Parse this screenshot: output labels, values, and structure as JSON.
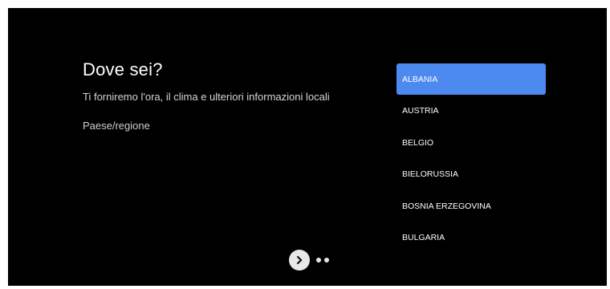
{
  "header": {
    "title": "Dove sei?",
    "subtitle": "Ti forniremo l'ora, il clima e ulteriori informazioni locali",
    "field_label": "Paese/regione"
  },
  "countries": [
    {
      "label": "ALBANIA",
      "selected": true
    },
    {
      "label": "AUSTRIA",
      "selected": false
    },
    {
      "label": "BELGIO",
      "selected": false
    },
    {
      "label": "BIELORUSSIA",
      "selected": false
    },
    {
      "label": "BOSNIA ERZEGOVINA",
      "selected": false
    },
    {
      "label": "BULGARIA",
      "selected": false
    }
  ],
  "colors": {
    "background": "#000000",
    "selected_item": "#4d8af0",
    "text": "#ffffff"
  },
  "icons": {
    "next": "chevron-right-icon",
    "pager": "page-dot"
  }
}
